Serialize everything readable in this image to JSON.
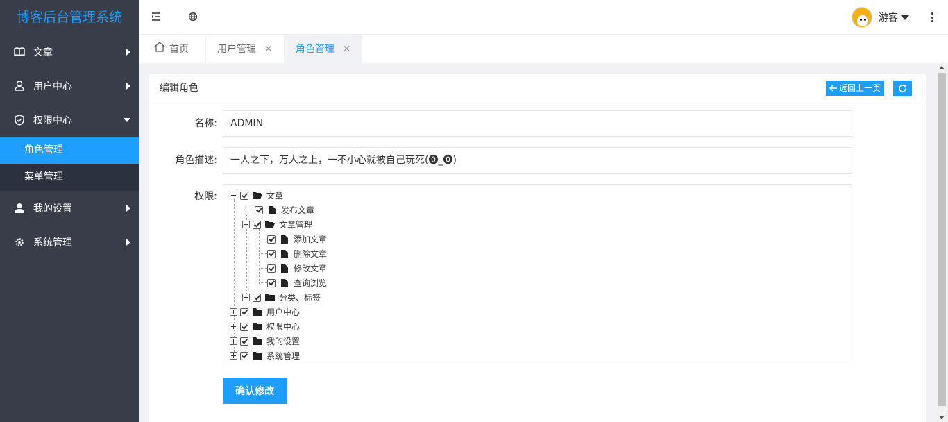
{
  "app": {
    "title": "博客后台管理系统"
  },
  "sidebar": {
    "items": [
      {
        "label": "文章",
        "icon": "book-icon"
      },
      {
        "label": "用户中心",
        "icon": "user-outline-icon"
      },
      {
        "label": "权限中心",
        "icon": "shield-icon"
      },
      {
        "label": "我的设置",
        "icon": "user-icon"
      },
      {
        "label": "系统管理",
        "icon": "gear-icon"
      }
    ],
    "sub_items": [
      {
        "label": "角色管理"
      },
      {
        "label": "菜单管理"
      }
    ]
  },
  "header": {
    "user_name": "游客",
    "icons": [
      "menu-fold-icon",
      "globe-icon",
      "more-vertical-icon"
    ]
  },
  "tabs": [
    {
      "label": "首页"
    },
    {
      "label": "用户管理"
    },
    {
      "label": "角色管理"
    }
  ],
  "card": {
    "title": "编辑角色",
    "back_label": "返回上一页"
  },
  "form": {
    "name_label": "名称:",
    "name_value": "ADMIN",
    "desc_label": "角色描述:",
    "desc_value": "一人之下，万人之上，一不小心就被自己玩死(⓿_⓿)",
    "perm_label": "权限:",
    "submit_label": "确认修改"
  },
  "tree": [
    {
      "label": "文章"
    },
    {
      "label": "发布文章"
    },
    {
      "label": "文章管理"
    },
    {
      "label": "添加文章"
    },
    {
      "label": "删除文章"
    },
    {
      "label": "修改文章"
    },
    {
      "label": "查询浏览"
    },
    {
      "label": "分类、标签"
    },
    {
      "label": "用户中心"
    },
    {
      "label": "权限中心"
    },
    {
      "label": "我的设置"
    },
    {
      "label": "系统管理"
    }
  ],
  "colors": {
    "accent": "#1e9fff",
    "sidebar": "#393d49"
  }
}
